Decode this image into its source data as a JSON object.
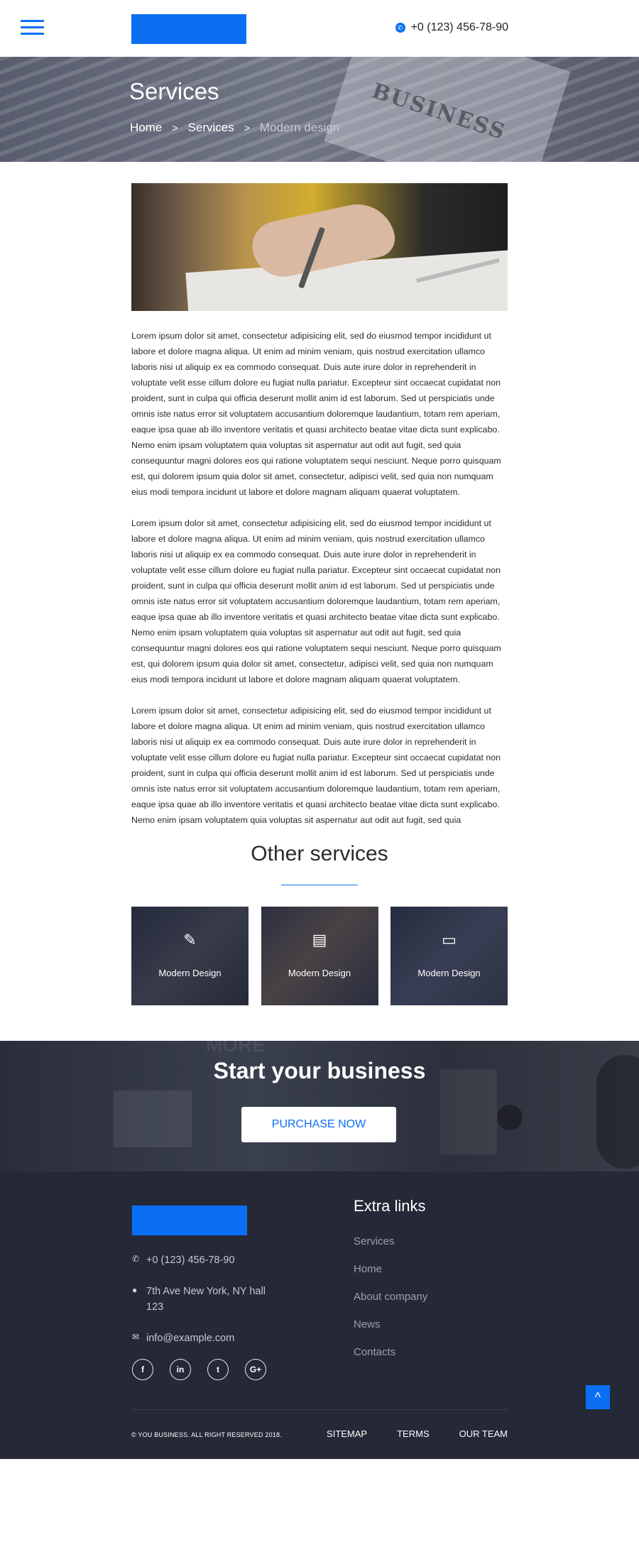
{
  "colors": {
    "accent": "#0b6ff4",
    "footer_bg": "#252836"
  },
  "header": {
    "phone": "+0 (123) 456-78-90",
    "phone_icon": "phone-icon",
    "menu_icon": "hamburger-menu-icon"
  },
  "hero": {
    "title": "Services",
    "breadcrumb": [
      {
        "label": "Home"
      },
      {
        "label": "Services"
      },
      {
        "label": "Modern design"
      }
    ],
    "separator": ">"
  },
  "main": {
    "paragraphs": [
      "Lorem ipsum dolor sit amet, consectetur adipisicing elit, sed do eiusmod tempor incididunt ut labore et dolore magna aliqua. Ut enim ad minim veniam, quis nostrud exercitation ullamco laboris nisi ut aliquip ex ea commodo consequat. Duis aute irure dolor in reprehenderit in voluptate velit esse cillum dolore eu fugiat nulla pariatur. Excepteur sint occaecat cupidatat non proident, sunt in culpa qui officia deserunt mollit anim id est laborum. Sed ut perspiciatis unde omnis iste natus error sit voluptatem accusantium doloremque laudantium, totam rem aperiam, eaque ipsa quae ab illo inventore veritatis et quasi architecto beatae vitae dicta sunt explicabo. Nemo enim ipsam voluptatem quia voluptas sit aspernatur aut odit aut fugit, sed quia consequuntur magni dolores eos qui ratione voluptatem sequi nesciunt. Neque porro quisquam est, qui dolorem ipsum quia dolor sit amet, consectetur, adipisci velit, sed quia non numquam eius modi tempora incidunt ut labore et dolore magnam aliquam quaerat voluptatem.",
      "Lorem ipsum dolor sit amet, consectetur adipisicing elit, sed do eiusmod tempor incididunt ut labore et dolore magna aliqua. Ut enim ad minim veniam, quis nostrud exercitation ullamco laboris nisi ut aliquip ex ea commodo consequat. Duis aute irure dolor in reprehenderit in voluptate velit esse cillum dolore eu fugiat nulla pariatur. Excepteur sint occaecat cupidatat non proident, sunt in culpa qui officia deserunt mollit anim id est laborum. Sed ut perspiciatis unde omnis iste natus error sit voluptatem accusantium doloremque laudantium, totam rem aperiam, eaque ipsa quae ab illo inventore veritatis et quasi architecto beatae vitae dicta sunt explicabo. Nemo enim ipsam voluptatem quia voluptas sit aspernatur aut odit aut fugit, sed quia consequuntur magni dolores eos qui ratione voluptatem sequi nesciunt. Neque porro quisquam est, qui dolorem ipsum quia dolor sit amet, consectetur, adipisci velit, sed quia non numquam eius modi tempora incidunt ut labore et dolore magnam aliquam quaerat voluptatem.",
      "Lorem ipsum dolor sit amet, consectetur adipisicing elit, sed do eiusmod tempor incididunt ut labore et dolore magna aliqua. Ut enim ad minim veniam, quis nostrud exercitation ullamco laboris nisi ut aliquip ex ea commodo consequat. Duis aute irure dolor in reprehenderit in voluptate velit esse cillum dolore eu fugiat nulla pariatur. Excepteur sint occaecat cupidatat non proident, sunt in culpa qui officia deserunt mollit anim id est laborum. Sed ut perspiciatis unde omnis iste natus error sit voluptatem accusantium doloremque laudantium, totam rem aperiam, eaque ipsa quae ab illo inventore veritatis et quasi architecto beatae vitae dicta sunt explicabo. Nemo enim ipsam voluptatem quia voluptas sit aspernatur aut odit aut fugit, sed quia"
    ]
  },
  "other_services": {
    "title": "Other services",
    "cards": [
      {
        "label": "Modern Design",
        "icon": "design-tools-icon",
        "glyph": "✎"
      },
      {
        "label": "Modern Design",
        "icon": "document-icon",
        "glyph": "▤"
      },
      {
        "label": "Modern Design",
        "icon": "browser-window-icon",
        "glyph": "▭"
      }
    ]
  },
  "cta": {
    "title": "Start your business",
    "button": "PURCHASE NOW",
    "bg_text": "MORE"
  },
  "footer": {
    "phone": "+0 (123) 456-78-90",
    "address": "7th Ave New York, NY hall 123",
    "email": "info@example.com",
    "socials": [
      {
        "name": "facebook-icon",
        "glyph": "f"
      },
      {
        "name": "linkedin-icon",
        "glyph": "in"
      },
      {
        "name": "twitter-icon",
        "glyph": "t"
      },
      {
        "name": "google-plus-icon",
        "glyph": "G+"
      }
    ],
    "links_title": "Extra links",
    "links": [
      "Services",
      "Home",
      "About company",
      "News",
      "Contacts"
    ],
    "copyright": "© YOU BUSINESS. ALL RIGHT RESERVED 2018.",
    "bottom_links": [
      "SITEMAP",
      "TERMS",
      "OUR TEAM"
    ],
    "to_top_glyph": "^"
  }
}
